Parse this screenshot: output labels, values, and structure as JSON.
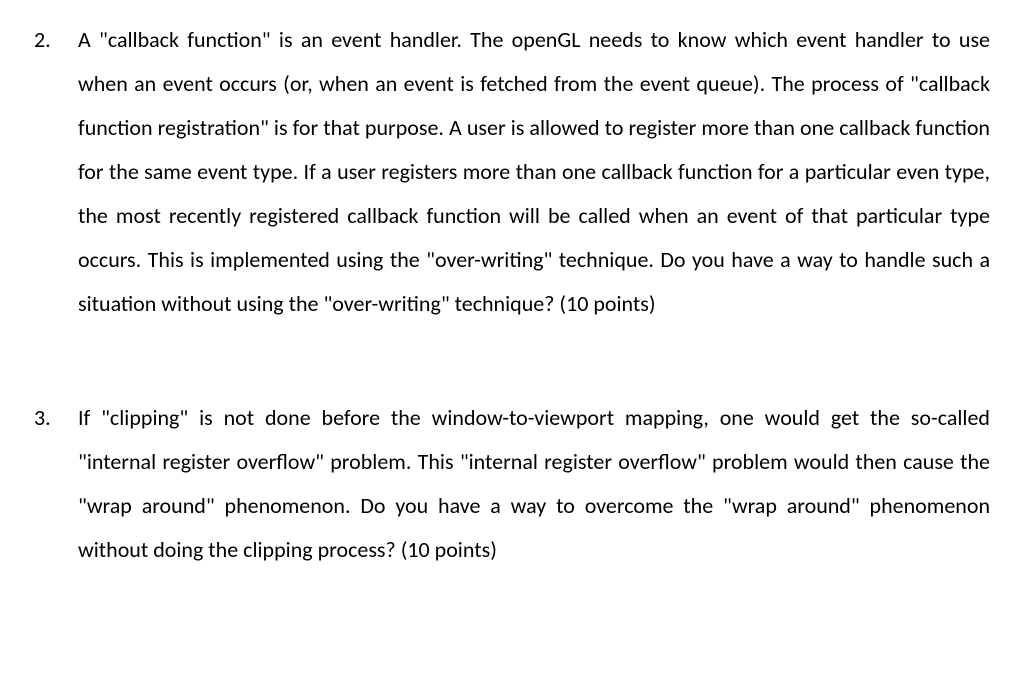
{
  "questions": [
    {
      "number": "2.",
      "text": "A \"callback function\" is an event handler.   The openGL needs to know which event handler to use when an event occurs (or, when an event is fetched from the event queue). The process of \"callback function registration\" is for that purpose. A user is allowed to register more than one callback function for the same event type.   If a user registers more than one callback function for a particular even type, the most recently registered callback function will be called when an event of that particular type occurs. This is implemented using the \"over-writing\" technique. Do you have a way to handle such a situation without using the \"over-writing\" technique?    (10 points)"
    },
    {
      "number": "3.",
      "text": "If \"clipping\" is not done before the window-to-viewport mapping, one would get the so-called \"internal register overflow\" problem.   This \"internal register overflow\" problem would then cause the \"wrap around\" phenomenon. Do you have a way to overcome the \"wrap around\" phenomenon without doing the clipping process? (10 points)"
    }
  ]
}
